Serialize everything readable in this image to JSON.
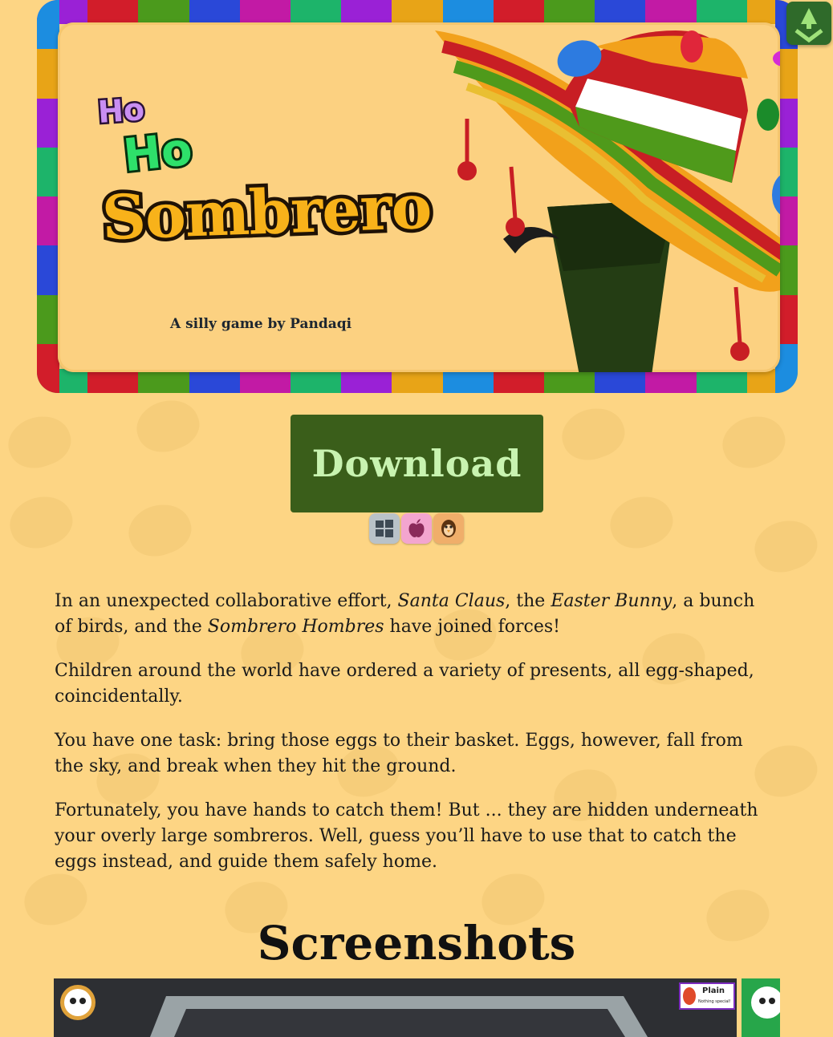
{
  "banner": {
    "title_ho1": "Ho",
    "title_ho2": "Ho",
    "title_main": "Sombrero",
    "tagline": "A silly game by Pandaqi",
    "border_colors": [
      "#1db46a",
      "#e8a417",
      "#1c8de0",
      "#d21d2a",
      "#4b9a1c",
      "#9a21d6",
      "#c21aa5",
      "#2a48d8"
    ]
  },
  "download": {
    "label": "Download",
    "platforms": [
      {
        "name": "windows-icon",
        "color": "#b9c2c8"
      },
      {
        "name": "apple-icon",
        "color": "#f3a5cf"
      },
      {
        "name": "linux-icon",
        "color": "#f0ae6a"
      }
    ]
  },
  "intro": {
    "p1_a": "In an unexpected collaborative effort, ",
    "p1_santa": "Santa Claus",
    "p1_b": ", the ",
    "p1_bunny": "Easter Bunny",
    "p1_c": ", a bunch of birds, and the ",
    "p1_hombres": "Sombrero Hombres",
    "p1_d": " have joined forces!",
    "p2": "Children around the world have ordered a variety of presents, all egg-shaped, coincidentally.",
    "p3": "You have one task: bring those eggs to their basket. Eggs, however, fall from the sky, and break when they hit the ground.",
    "p4": "Fortunately, you have hands to catch them! But ... they are hidden underneath your overly large sombreros. Well, guess you’ll have to use that to catch the eggs instead, and guide them safely home."
  },
  "screenshots": {
    "heading": "Screenshots",
    "badge_title": "Plain",
    "badge_sub": "Nothing special!"
  },
  "colors": {
    "background": "#fdd584",
    "download_bg": "#3a5e1a",
    "download_text": "#c8f3b0"
  }
}
